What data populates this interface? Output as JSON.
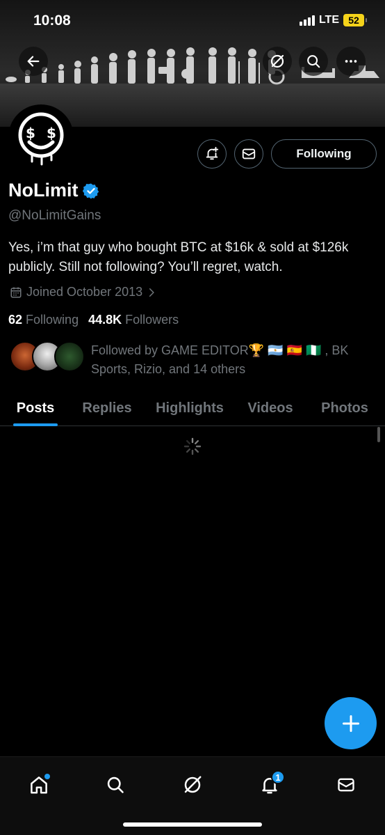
{
  "status": {
    "time": "10:08",
    "network": "LTE",
    "battery": "52"
  },
  "profile": {
    "name": "NoLimit",
    "handle": "@NoLimitGains",
    "bio": "Yes, i’m that guy who bought BTC at $16k & sold at $126k publicly. Still not following? You’ll regret, watch.",
    "joined": "Joined October 2013",
    "following_count": "62",
    "following_label": "Following",
    "followers_count": "44.8K",
    "followers_label": "Followers",
    "followed_by": "Followed by GAME EDITOR🏆 🇦🇷 🇪🇸 🇳🇬 , BK Sports, Rizio, and 14 others",
    "follow_button": "Following"
  },
  "tabs": [
    "Posts",
    "Replies",
    "Highlights",
    "Videos",
    "Photos"
  ],
  "active_tab": "Posts",
  "bottom_nav": {
    "notification_count": "1"
  },
  "colors": {
    "accent": "#1d9bf0",
    "background": "#000000",
    "muted": "#71767b"
  },
  "icons": [
    "back-arrow-icon",
    "grok-icon",
    "search-icon",
    "more-icon",
    "bell-plus-icon",
    "mail-icon",
    "verified-badge-icon",
    "calendar-icon",
    "chevron-right-icon",
    "plus-icon",
    "home-icon",
    "explore-icon",
    "notifications-icon"
  ]
}
